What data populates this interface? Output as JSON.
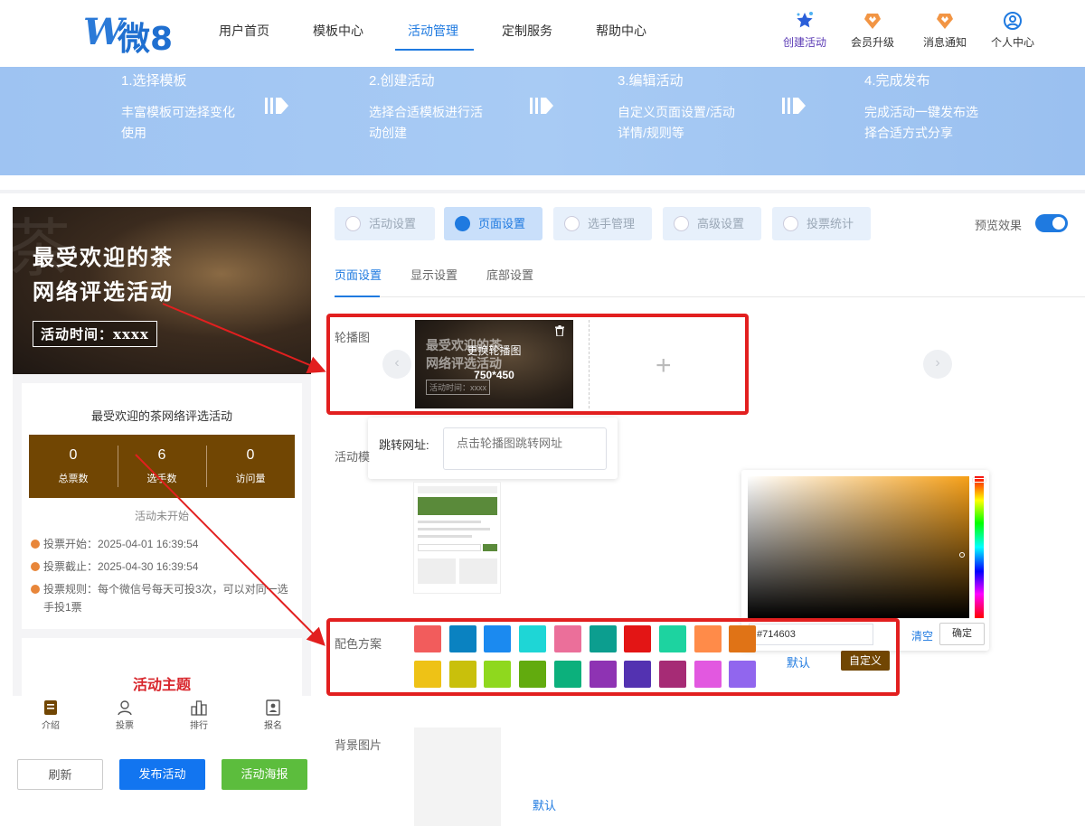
{
  "logo": {
    "mark": "W",
    "text": "微8"
  },
  "nav": [
    "用户首页",
    "模板中心",
    "活动管理",
    "定制服务",
    "帮助中心"
  ],
  "nav_active": "活动管理",
  "right_nav": [
    {
      "label": "创建活动",
      "icon": "star-icon"
    },
    {
      "label": "会员升级",
      "icon": "crown-icon"
    },
    {
      "label": "消息通知",
      "icon": "crown-icon"
    },
    {
      "label": "个人中心",
      "icon": "user-icon"
    }
  ],
  "steps": [
    {
      "title": "1.选择模板",
      "desc": "丰富模板可选择变化使用"
    },
    {
      "title": "2.创建活动",
      "desc": "选择合适模板进行活动创建"
    },
    {
      "title": "3.编辑活动",
      "desc": "自定义页面设置/活动详情/规则等"
    },
    {
      "title": "4.完成发布",
      "desc": "完成活动一键发布选择合适方式分享"
    }
  ],
  "hero": {
    "watermark": "茶",
    "line1": "最受欢迎的茶",
    "line2": "网络评选活动",
    "tag": "活动时间：xxxx"
  },
  "card": {
    "title": "最受欢迎的茶网络评选活动",
    "stats": [
      {
        "value": "0",
        "label": "总票数"
      },
      {
        "value": "6",
        "label": "选手数"
      },
      {
        "value": "0",
        "label": "访问量"
      }
    ],
    "status": "活动未开始",
    "start": "投票开始：2025-04-01 16:39:54",
    "end": "投票截止：2025-04-30 16:39:54",
    "rule": "投票规则：每个微信号每天可投3次，可以对同一选手投1票"
  },
  "theme_title": "活动主题",
  "bottom_nav": [
    "介绍",
    "投票",
    "排行",
    "报名"
  ],
  "buttons": {
    "refresh": "刷新",
    "publish": "发布活动",
    "poster": "活动海报"
  },
  "tabs": [
    "活动设置",
    "页面设置",
    "选手管理",
    "高级设置",
    "投票统计"
  ],
  "tab_active": "页面设置",
  "preview_label": "预览效果",
  "preview_on": true,
  "subtabs": [
    "页面设置",
    "显示设置",
    "底部设置"
  ],
  "carousel": {
    "label": "轮播图",
    "replace": "更换轮播图",
    "size": "750*450",
    "thumb_line1": "最受欢迎的茶",
    "thumb_line2": "网络评选活动",
    "thumb_tag": "活动时间：xxxx"
  },
  "jump": {
    "label": "跳转网址:",
    "placeholder": "点击轮播图跳转网址"
  },
  "template_label": "活动模",
  "color_label": "配色方案",
  "colors_row1": [
    "#f25c5c",
    "#0a82c1",
    "#1b8af0",
    "#1ed6d6",
    "#eb6f9a",
    "#0c9e8f",
    "#e31515",
    "#1dd3a0",
    "#ff8b49",
    "#e07316"
  ],
  "colors_row2": [
    "#eec216",
    "#c9c00b",
    "#8fd81e",
    "#62ab0e",
    "#0cb07c",
    "#8e33b3",
    "#5332b1",
    "#a62b75",
    "#e258e0",
    "#9166ee"
  ],
  "picker": {
    "hex": "#714603",
    "clear": "清空",
    "confirm": "确定",
    "selected": "#714603"
  },
  "default_label": "默认",
  "custom_label": "自定义",
  "bg_label": "背景图片",
  "bg_default": "默认"
}
